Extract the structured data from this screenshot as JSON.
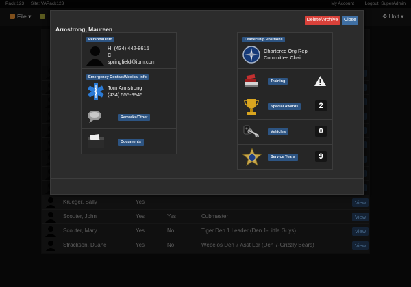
{
  "topbar": {
    "pack": "Pack 123",
    "site": "Site: VAPack123",
    "my_account": "My Account",
    "logout": "Logout: SuperAdmin"
  },
  "nav": {
    "file": "File",
    "unit": "Unit"
  },
  "roster": {
    "rows": [
      {
        "name": "Krueger, Sally",
        "active": "Yes",
        "col3": "",
        "position": "",
        "action": "View"
      },
      {
        "name": "Scouter, John",
        "active": "Yes",
        "col3": "Yes",
        "position": "Cubmaster",
        "action": "View"
      },
      {
        "name": "Scouter, Mary",
        "active": "Yes",
        "col3": "No",
        "position": "Tiger Den 1 Leader (Den 1-Little Guys)",
        "action": "View"
      },
      {
        "name": "Strackson, Duane",
        "active": "Yes",
        "col3": "No",
        "position": "Webelos Den 7 Asst Ldr (Den 7-Grizzly Bears)",
        "action": "View"
      }
    ]
  },
  "modal": {
    "name": "Armstrong, Maureen",
    "delete_label": "Delete/Archive",
    "close_label": "Close",
    "personal": {
      "tag": "Personal Info",
      "home": "H: (434) 442-8615",
      "cell": "C:",
      "email": "springfield@ibm.com"
    },
    "emergency": {
      "tag": "Emergency Contact/Medical Info",
      "contact_name": "Tom Armstrong",
      "contact_phone": "(434) 555-9945"
    },
    "remarks": {
      "tag": "Remarks/Other"
    },
    "documents": {
      "tag": "Documents"
    },
    "leadership": {
      "tag": "Leadership Positions",
      "line1": "Chartered Org Rep",
      "line2": "Committee Chair"
    },
    "training": {
      "tag": "Training",
      "icon": "warning-icon"
    },
    "special_awards": {
      "tag": "Special Awards",
      "count": "2"
    },
    "vehicles": {
      "tag": "Vehicles",
      "count": "0"
    },
    "service_years": {
      "tag": "Service Years",
      "count": "9"
    }
  },
  "colors": {
    "danger": "#d9413a",
    "primary": "#3f6fa3",
    "tag": "#2d5482"
  }
}
